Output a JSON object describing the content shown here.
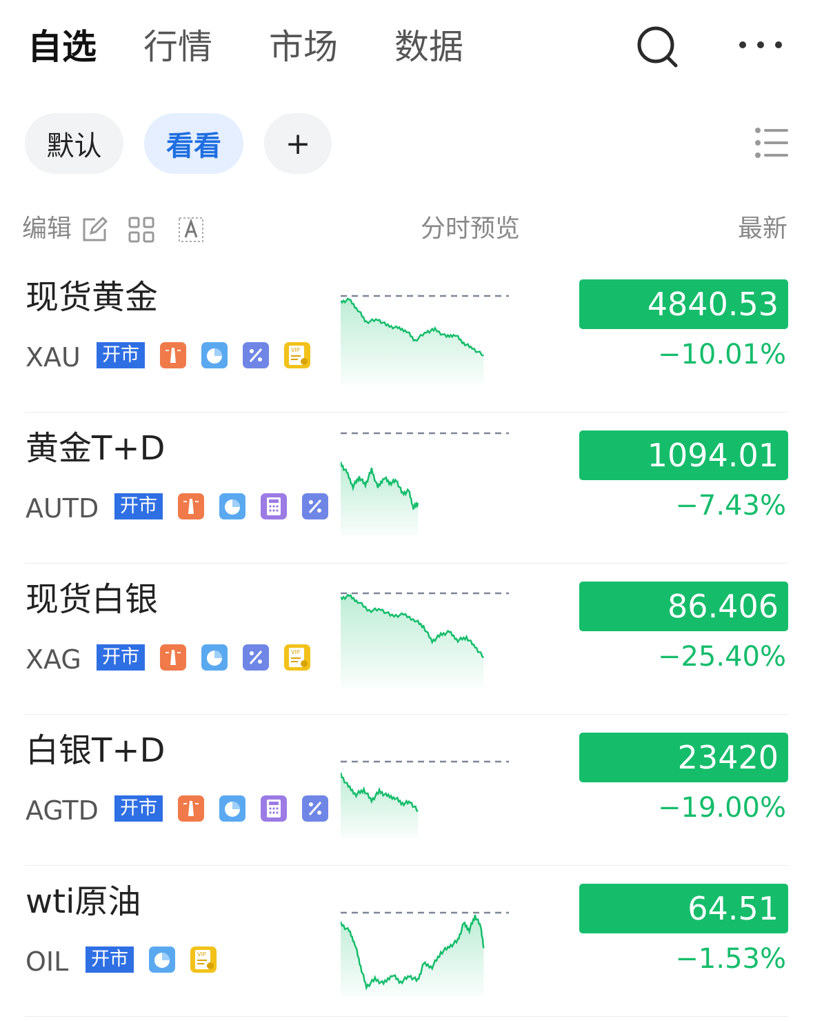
{
  "nav": {
    "tabs": [
      "自选",
      "行情",
      "市场",
      "数据"
    ],
    "active": 0
  },
  "groups": {
    "items": [
      "默认",
      "看看",
      "+"
    ],
    "selected": 1
  },
  "header": {
    "edit": "编辑",
    "preview": "分时预览",
    "latest": "最新"
  },
  "colors": {
    "up_down_green": "#15bd6b",
    "accent_blue": "#2f6fe4"
  },
  "rows": [
    {
      "name": "现货黄金",
      "code": "XAU",
      "status": "开市",
      "icons": [
        "lighthouse-icon",
        "pie-chart-icon",
        "percent-icon",
        "vip-icon"
      ],
      "price": "4840.53",
      "change": "−10.01%"
    },
    {
      "name": "黄金T+D",
      "code": "AUTD",
      "status": "开市",
      "icons": [
        "lighthouse-icon",
        "pie-chart-icon",
        "calculator-icon",
        "percent-icon"
      ],
      "price": "1094.01",
      "change": "−7.43%"
    },
    {
      "name": "现货白银",
      "code": "XAG",
      "status": "开市",
      "icons": [
        "lighthouse-icon",
        "pie-chart-icon",
        "percent-icon",
        "vip-icon"
      ],
      "price": "86.406",
      "change": "−25.40%"
    },
    {
      "name": "白银T+D",
      "code": "AGTD",
      "status": "开市",
      "icons": [
        "lighthouse-icon",
        "pie-chart-icon",
        "calculator-icon",
        "percent-icon"
      ],
      "price": "23420",
      "change": "−19.00%"
    },
    {
      "name": "wti原油",
      "code": "OIL",
      "status": "开市",
      "icons": [
        "pie-chart-icon",
        "vip-icon"
      ],
      "price": "64.51",
      "change": "−1.53%"
    }
  ]
}
